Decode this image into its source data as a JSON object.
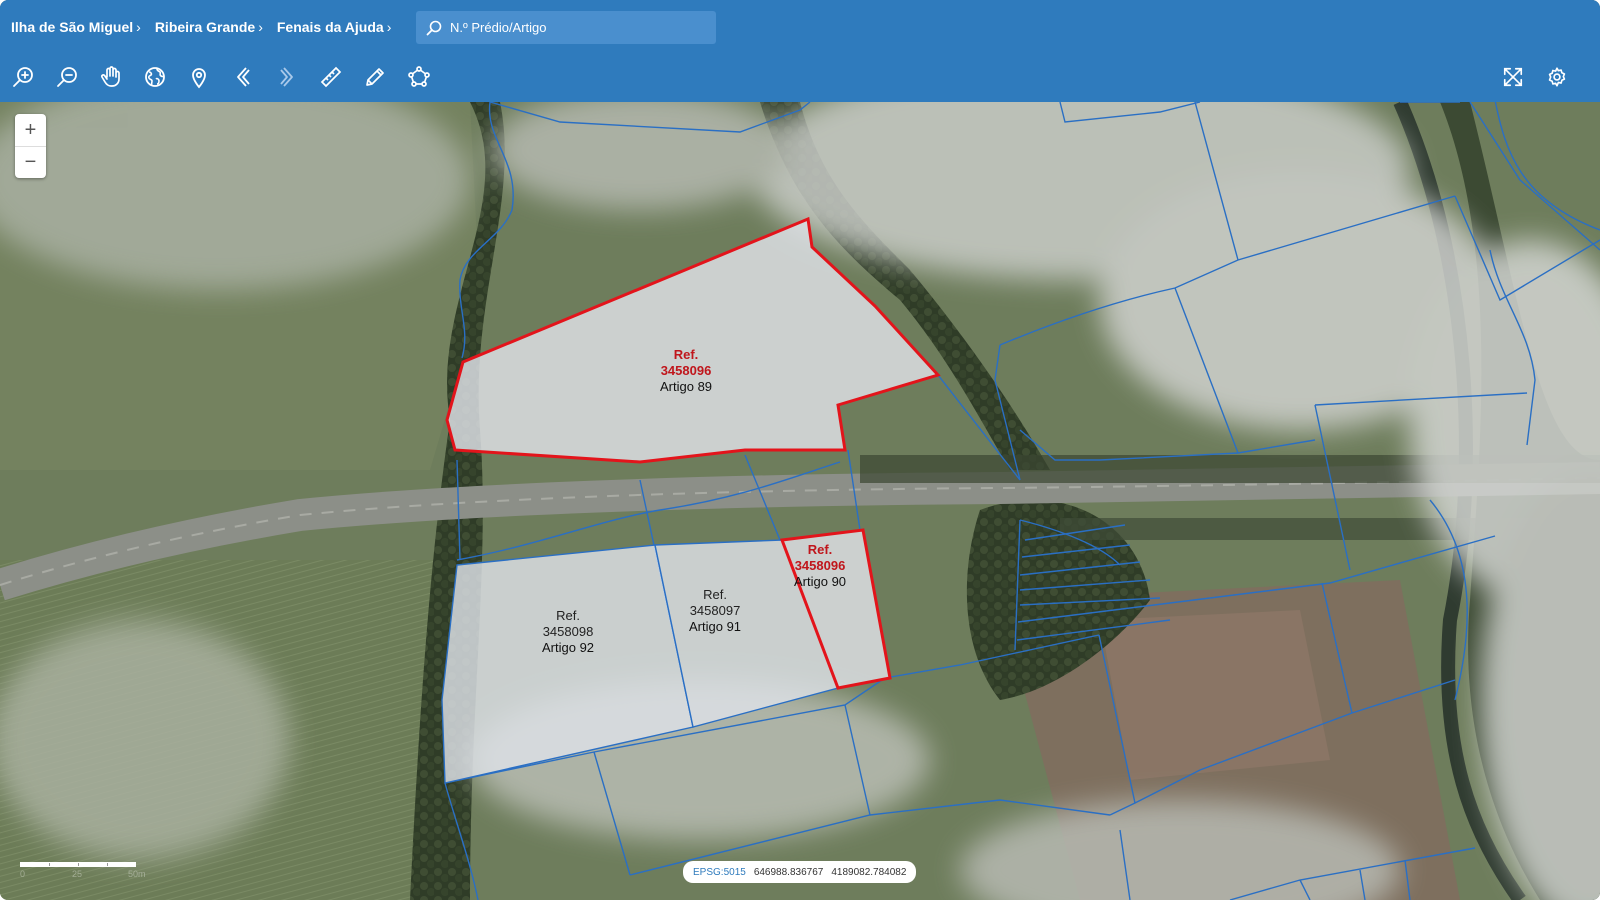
{
  "breadcrumb": [
    {
      "label": "Ilha de São Miguel"
    },
    {
      "label": "Ribeira Grande"
    },
    {
      "label": "Fenais da Ajuda"
    }
  ],
  "search": {
    "placeholder": "N.º Prédio/Artigo",
    "value": ""
  },
  "toolbar": {
    "tools": [
      "zoom-in-icon",
      "zoom-out-icon",
      "pan-hand-icon",
      "globe-icon",
      "location-pin-icon",
      "previous-view-icon",
      "next-view-icon",
      "measure-ruler-icon",
      "draw-pencil-icon",
      "polygon-select-icon"
    ],
    "right_tools": [
      "fullscreen-icon",
      "settings-gear-icon"
    ]
  },
  "map_controls": {
    "zoom_in_label": "+",
    "zoom_out_label": "−"
  },
  "parcels": [
    {
      "ref_label": "Ref.",
      "ref_number": "3458096",
      "artigo": "Artigo 89",
      "highlighted": true
    },
    {
      "ref_label": "Ref.",
      "ref_number": "3458096",
      "artigo": "Artigo 90",
      "highlighted": true
    },
    {
      "ref_label": "Ref.",
      "ref_number": "3458097",
      "artigo": "Artigo 91",
      "highlighted": false
    },
    {
      "ref_label": "Ref.",
      "ref_number": "3458098",
      "artigo": "Artigo 92",
      "highlighted": false
    }
  ],
  "coordinates": {
    "epsg": "EPSG:5015",
    "x": "646988.836767",
    "y": "4189082.784082"
  },
  "scale": {
    "labels": [
      "0",
      "25",
      "50m"
    ]
  },
  "colors": {
    "header": "#2f7bbd",
    "parcel_line": "#2a6fc4",
    "highlight": "#e3141b"
  }
}
